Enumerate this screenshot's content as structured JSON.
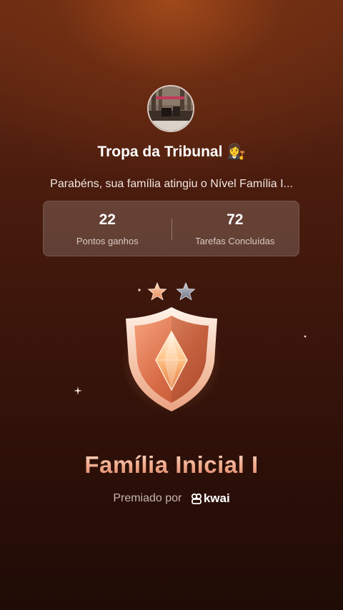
{
  "group": {
    "name": "Tropa da Tribunal",
    "emoji": "👩‍⚖️"
  },
  "congrats_text": "Parabéns, sua família atingiu o Nível Família I...",
  "stats": {
    "points": {
      "value": "22",
      "label": "Pontos ganhos"
    },
    "tasks": {
      "value": "72",
      "label": "Tarefas Concluídas"
    }
  },
  "level": {
    "title": "Família Inicial I",
    "stars_earned": 1,
    "stars_total": 2
  },
  "awarded_by": {
    "label": "Premiado por",
    "brand": "kwai"
  },
  "colors": {
    "background_top": "#a0491a",
    "background_bottom": "#200b06",
    "accent": "#f2b39a",
    "badge": "#e58a62"
  }
}
